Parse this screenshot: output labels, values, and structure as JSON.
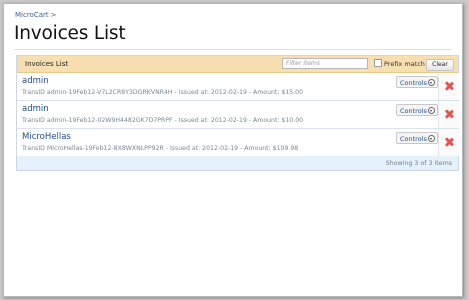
{
  "breadcrumb": {
    "item": "MicroCart",
    "separator": ">"
  },
  "page": {
    "title": "Invoices List"
  },
  "list": {
    "title": "Invoices List",
    "filter_placeholder": "Filter items",
    "prefix_label": "Prefix match",
    "prefix_checked": false,
    "clear_label": "Clear",
    "rows": [
      {
        "name": "admin",
        "detail": "TransID admin-19Feb12-V7L2CR8Y3DGRKVNR4H - Issued at: 2012-02-19 - Amount: $15.00",
        "controls": "Controls"
      },
      {
        "name": "admin",
        "detail": "TransID admin-19Feb12-02W9H4482GK7D7PRPF - Issued at: 2012-02-19 - Amount: $10.00",
        "controls": "Controls"
      },
      {
        "name": "MicroHellas",
        "detail": "TransID MicroHellas-19Feb12-8X8WXNLPP92R - Issued at: 2012-02-19 - Amount: $109.98",
        "controls": "Controls"
      }
    ],
    "footer": "Showing 3 of 3 items"
  }
}
